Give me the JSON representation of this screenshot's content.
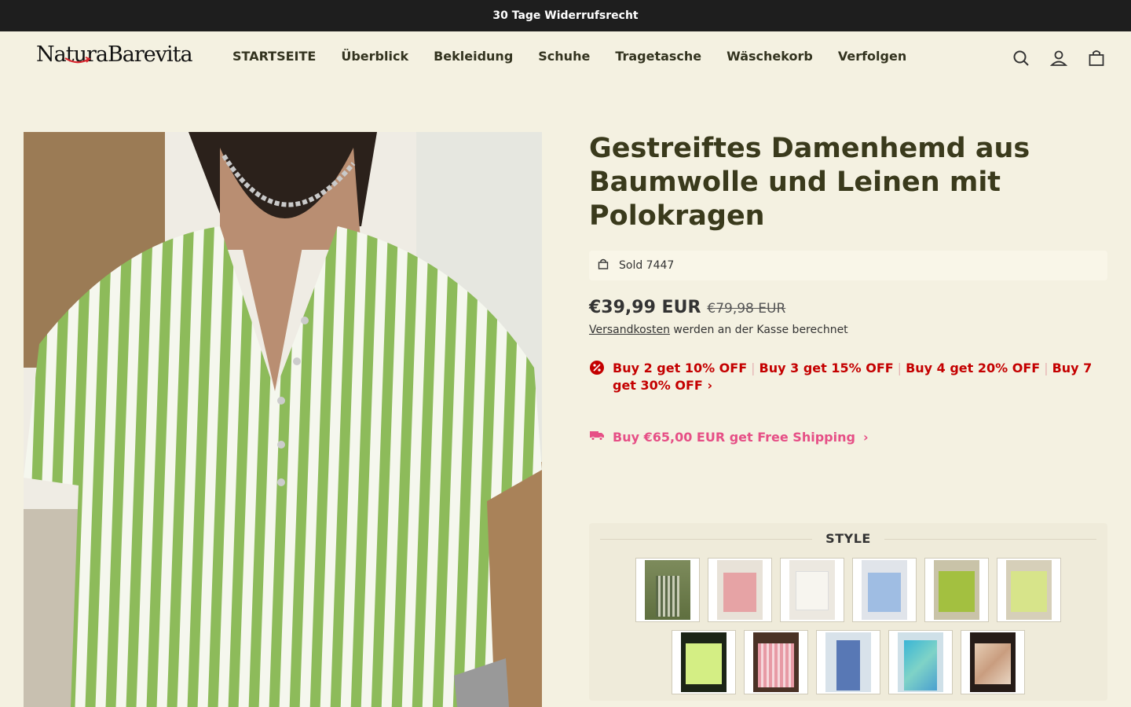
{
  "announcement": "30 Tage Widerrufsrecht",
  "header": {
    "logo": "NaturaBarevita",
    "nav": [
      "STARTSEITE",
      "Überblick",
      "Bekleidung",
      "Schuhe",
      "Tragetasche",
      "Wäschekorb",
      "Verfolgen"
    ],
    "icons": [
      "search-icon",
      "account-icon",
      "cart-icon"
    ]
  },
  "product": {
    "title": "Gestreiftes Damenhemd aus Baumwolle und Leinen mit Polokragen",
    "sold_label": "Sold 7447",
    "price": "€39,99 EUR",
    "compare_price": "€79,98 EUR",
    "shipping_link": "Versandkosten",
    "shipping_text": " werden an der Kasse berechnet",
    "promos": [
      "Buy 2 get 10% OFF",
      "Buy 3 get 15% OFF",
      "Buy 4 get 20% OFF",
      "Buy 7 get 30% OFF"
    ],
    "free_shipping": "Buy €65,00 EUR get Free Shipping",
    "style_label": "STYLE"
  },
  "colors": {
    "promo": "#c40000",
    "free_shipping": "#e64f86",
    "stripe_green": "#8dbb5a"
  }
}
